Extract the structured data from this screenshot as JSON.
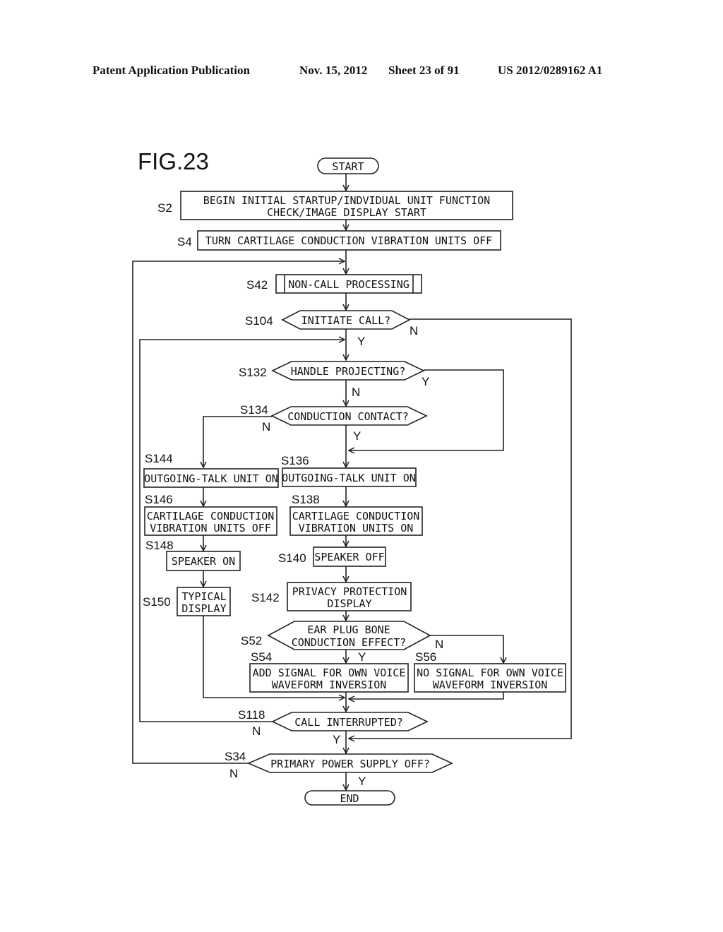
{
  "header": {
    "publication": "Patent Application Publication",
    "date": "Nov. 15, 2012",
    "sheet": "Sheet 23 of 91",
    "number": "US 2012/0289162 A1"
  },
  "figure": {
    "label": "FIG.23",
    "terminals": {
      "start": "START",
      "end": "END"
    },
    "steps": {
      "S2": {
        "id": "S2",
        "lines": [
          "BEGIN INITIAL STARTUP/INDVIDUAL UNIT FUNCTION",
          "CHECK/IMAGE DISPLAY START"
        ]
      },
      "S4": {
        "id": "S4",
        "lines": [
          "TURN CARTILAGE CONDUCTION VIBRATION UNITS OFF"
        ]
      },
      "S42": {
        "id": "S42",
        "lines": [
          "NON-CALL PROCESSING"
        ]
      },
      "S104": {
        "id": "S104",
        "lines": [
          "INITIATE CALL?"
        ]
      },
      "S132": {
        "id": "S132",
        "lines": [
          "HANDLE PROJECTING?"
        ]
      },
      "S134": {
        "id": "S134",
        "lines": [
          "CONDUCTION CONTACT?"
        ]
      },
      "S144": {
        "id": "S144",
        "lines": [
          "OUTGOING-TALK UNIT ON"
        ]
      },
      "S136": {
        "id": "S136",
        "lines": [
          "OUTGOING-TALK UNIT ON"
        ]
      },
      "S146": {
        "id": "S146",
        "lines": [
          "CARTILAGE CONDUCTION",
          "VIBRATION UNITS OFF"
        ]
      },
      "S138": {
        "id": "S138",
        "lines": [
          "CARTILAGE CONDUCTION",
          "VIBRATION UNITS ON"
        ]
      },
      "S148": {
        "id": "S148",
        "lines": [
          "SPEAKER ON"
        ]
      },
      "S140": {
        "id": "S140",
        "lines": [
          "SPEAKER OFF"
        ]
      },
      "S150": {
        "id": "S150",
        "lines": [
          "TYPICAL",
          "DISPLAY"
        ]
      },
      "S142": {
        "id": "S142",
        "lines": [
          "PRIVACY PROTECTION",
          "DISPLAY"
        ]
      },
      "S52": {
        "id": "S52",
        "lines": [
          "EAR PLUG BONE",
          "CONDUCTION EFFECT?"
        ]
      },
      "S54": {
        "id": "S54",
        "lines": [
          "ADD SIGNAL FOR OWN VOICE",
          "WAVEFORM INVERSION"
        ]
      },
      "S56": {
        "id": "S56",
        "lines": [
          "NO SIGNAL FOR OWN VOICE",
          "WAVEFORM INVERSION"
        ]
      },
      "S118": {
        "id": "S118",
        "lines": [
          "CALL INTERRUPTED?"
        ]
      },
      "S34": {
        "id": "S34",
        "lines": [
          "PRIMARY POWER SUPPLY OFF?"
        ]
      }
    },
    "branch_labels": {
      "yes": "Y",
      "no": "N"
    }
  }
}
